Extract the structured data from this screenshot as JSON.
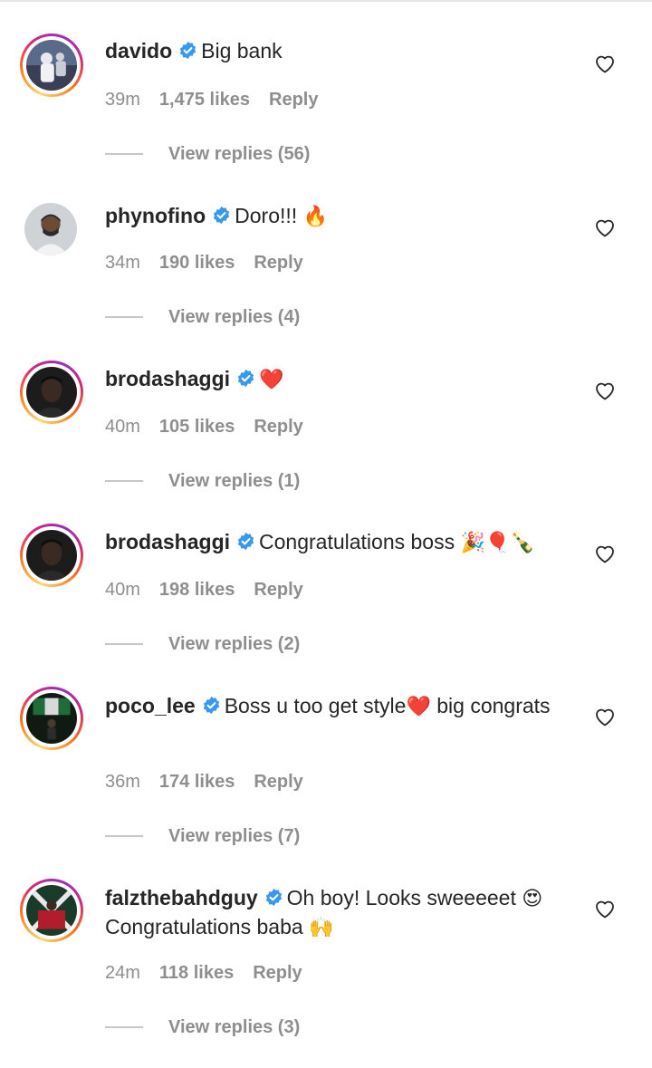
{
  "comments": [
    {
      "username": "davido",
      "text": "Big bank",
      "emoji": "",
      "time": "39m",
      "likes": "1,475 likes",
      "reply": "Reply",
      "view_replies": "View replies (56)",
      "avatar_ring": true
    },
    {
      "username": "phynofino",
      "text": "Doro!!! ",
      "emoji": "🔥",
      "time": "34m",
      "likes": "190 likes",
      "reply": "Reply",
      "view_replies": "View replies (4)",
      "avatar_ring": false
    },
    {
      "username": "brodashaggi",
      "text": "",
      "emoji": "❤️",
      "time": "40m",
      "likes": "105 likes",
      "reply": "Reply",
      "view_replies": "View replies (1)",
      "avatar_ring": true
    },
    {
      "username": "brodashaggi",
      "text": "Congratulations boss ",
      "emoji": "🎉🎈🍾",
      "time": "40m",
      "likes": "198 likes",
      "reply": "Reply",
      "view_replies": "View replies (2)",
      "avatar_ring": true
    },
    {
      "username": "poco_lee",
      "text": "Boss u too get style",
      "emoji": "❤️",
      "text_after": " big congrats",
      "time": "36m",
      "likes": "174 likes",
      "reply": "Reply",
      "view_replies": "View replies (7)",
      "avatar_ring": true
    },
    {
      "username": "falzthebahdguy",
      "text": "Oh boy! Looks sweeeeet ",
      "emoji": "😍",
      "text_after": " Congratulations baba ",
      "emoji_after": "🙌",
      "time": "24m",
      "likes": "118 likes",
      "reply": "Reply",
      "view_replies": "View replies (3)",
      "avatar_ring": true
    }
  ],
  "colors": {
    "verified": "#3897f0",
    "meta_text": "#8e8e8e",
    "primary_text": "#262626",
    "heart_fire": "#ff6a00",
    "heart_red": "#e0245e"
  },
  "icons": {
    "verified": "verified-badge-icon",
    "like": "heart-outline-icon"
  }
}
